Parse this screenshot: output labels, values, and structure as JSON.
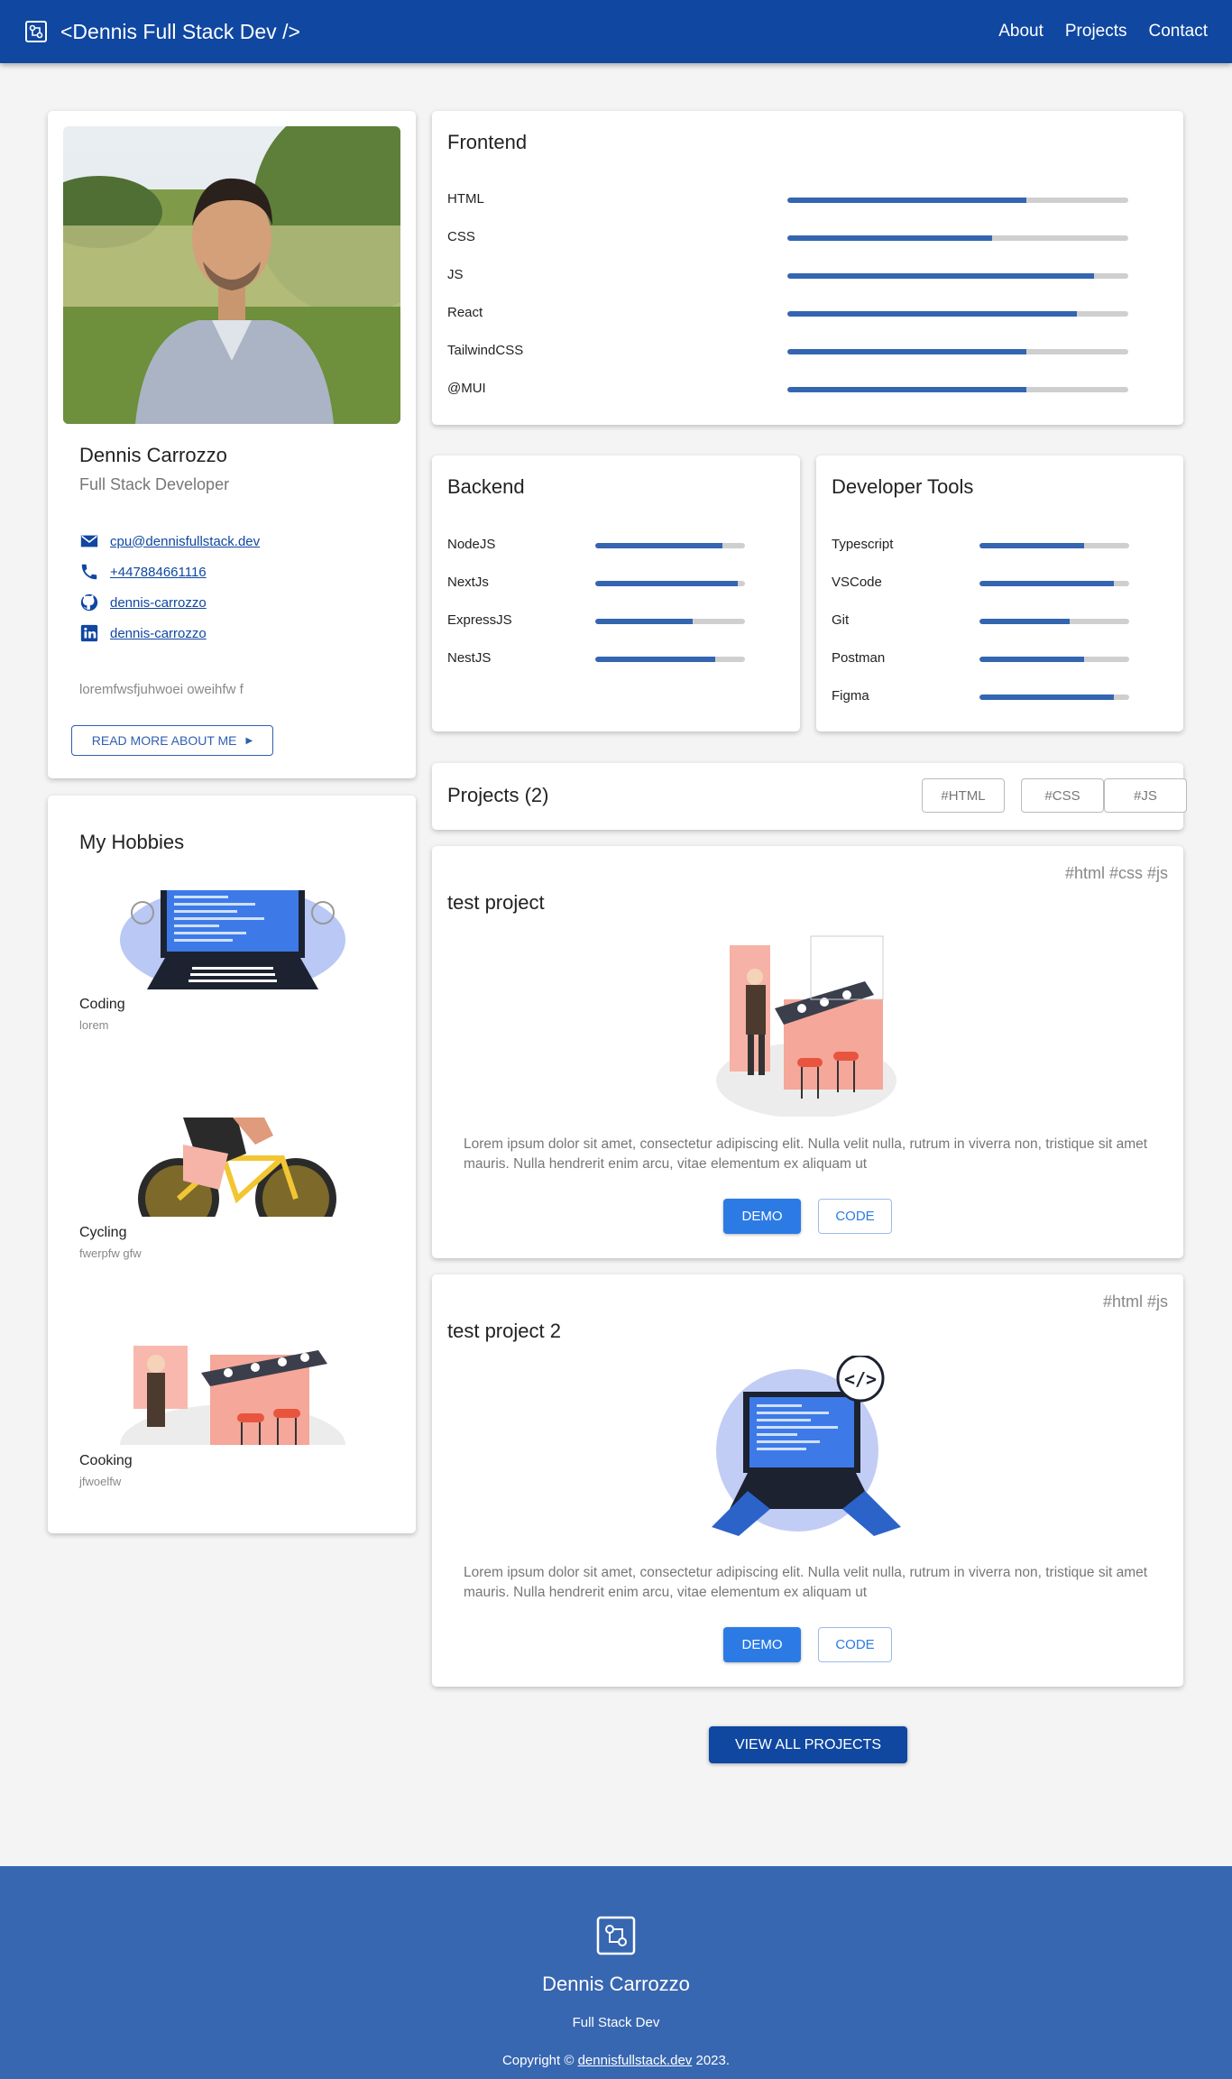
{
  "nav": {
    "brand": "<Dennis Full Stack Dev />",
    "links": [
      "About",
      "Projects",
      "Contact"
    ]
  },
  "profile": {
    "name": "Dennis Carrozzo",
    "role": "Full Stack Developer",
    "email": "cpu@dennisfullstack.dev",
    "phone": "+447884661116",
    "github": "dennis-carrozzo",
    "linkedin": "dennis-carrozzo",
    "bio": "loremfwsfjuhwoei oweihfw f",
    "read_more": "READ MORE ABOUT ME"
  },
  "skills": {
    "frontend": {
      "title": "Frontend",
      "items": [
        {
          "label": "HTML",
          "level": 0.7
        },
        {
          "label": "CSS",
          "level": 0.6
        },
        {
          "label": "JS",
          "level": 0.9
        },
        {
          "label": "React",
          "level": 0.85
        },
        {
          "label": "TailwindCSS",
          "level": 0.7
        },
        {
          "label": "@MUI",
          "level": 0.7
        }
      ]
    },
    "backend": {
      "title": "Backend",
      "items": [
        {
          "label": "NodeJS",
          "level": 0.85
        },
        {
          "label": "NextJs",
          "level": 0.95
        },
        {
          "label": "ExpressJS",
          "level": 0.65
        },
        {
          "label": "NestJS",
          "level": 0.8
        }
      ]
    },
    "tools": {
      "title": "Developer Tools",
      "items": [
        {
          "label": "Typescript",
          "level": 0.7
        },
        {
          "label": "VSCode",
          "level": 0.9
        },
        {
          "label": "Git",
          "level": 0.6
        },
        {
          "label": "Postman",
          "level": 0.7
        },
        {
          "label": "Figma",
          "level": 0.9
        }
      ]
    }
  },
  "hobbies": {
    "title": "My Hobbies",
    "items": [
      {
        "name": "Coding",
        "desc": "lorem",
        "icon": "coding-illustration"
      },
      {
        "name": "Cycling",
        "desc": "fwerpfw gfw",
        "icon": "cycling-illustration"
      },
      {
        "name": "Cooking",
        "desc": "jfwoelfw",
        "icon": "cooking-illustration"
      }
    ]
  },
  "projects": {
    "title": "Projects (2)",
    "filters": [
      "#HTML",
      "#CSS",
      "#JS"
    ],
    "items": [
      {
        "title": "test project",
        "tags": "#html  #css  #js",
        "desc": "Lorem ipsum dolor sit amet, consectetur adipiscing elit. Nulla velit nulla, rutrum in viverra non, tristique sit amet mauris. Nulla hendrerit enim arcu, vitae elementum ex aliquam ut",
        "demo": "DEMO",
        "code": "CODE",
        "icon": "chef-kitchen-illustration"
      },
      {
        "title": "test project 2",
        "tags": "#html  #js",
        "desc": "Lorem ipsum dolor sit amet, consectetur adipiscing elit. Nulla velit nulla, rutrum in viverra non, tristique sit amet mauris. Nulla hendrerit enim arcu, vitae elementum ex aliquam ut",
        "demo": "DEMO",
        "code": "CODE",
        "icon": "laptop-code-illustration"
      }
    ],
    "view_all": "VIEW ALL PROJECTS"
  },
  "footer": {
    "name": "Dennis Carrozzo",
    "role": "Full Stack Dev",
    "copy_prefix": "Copyright © ",
    "copy_link": "dennisfullstack.dev",
    "copy_suffix": " 2023."
  },
  "colors": {
    "primary": "#0f47a1",
    "footer": "#3867b1",
    "bar_fill": "#3465b0",
    "bar_track": "#cfcfcf",
    "demo_button": "#2c7be5"
  }
}
